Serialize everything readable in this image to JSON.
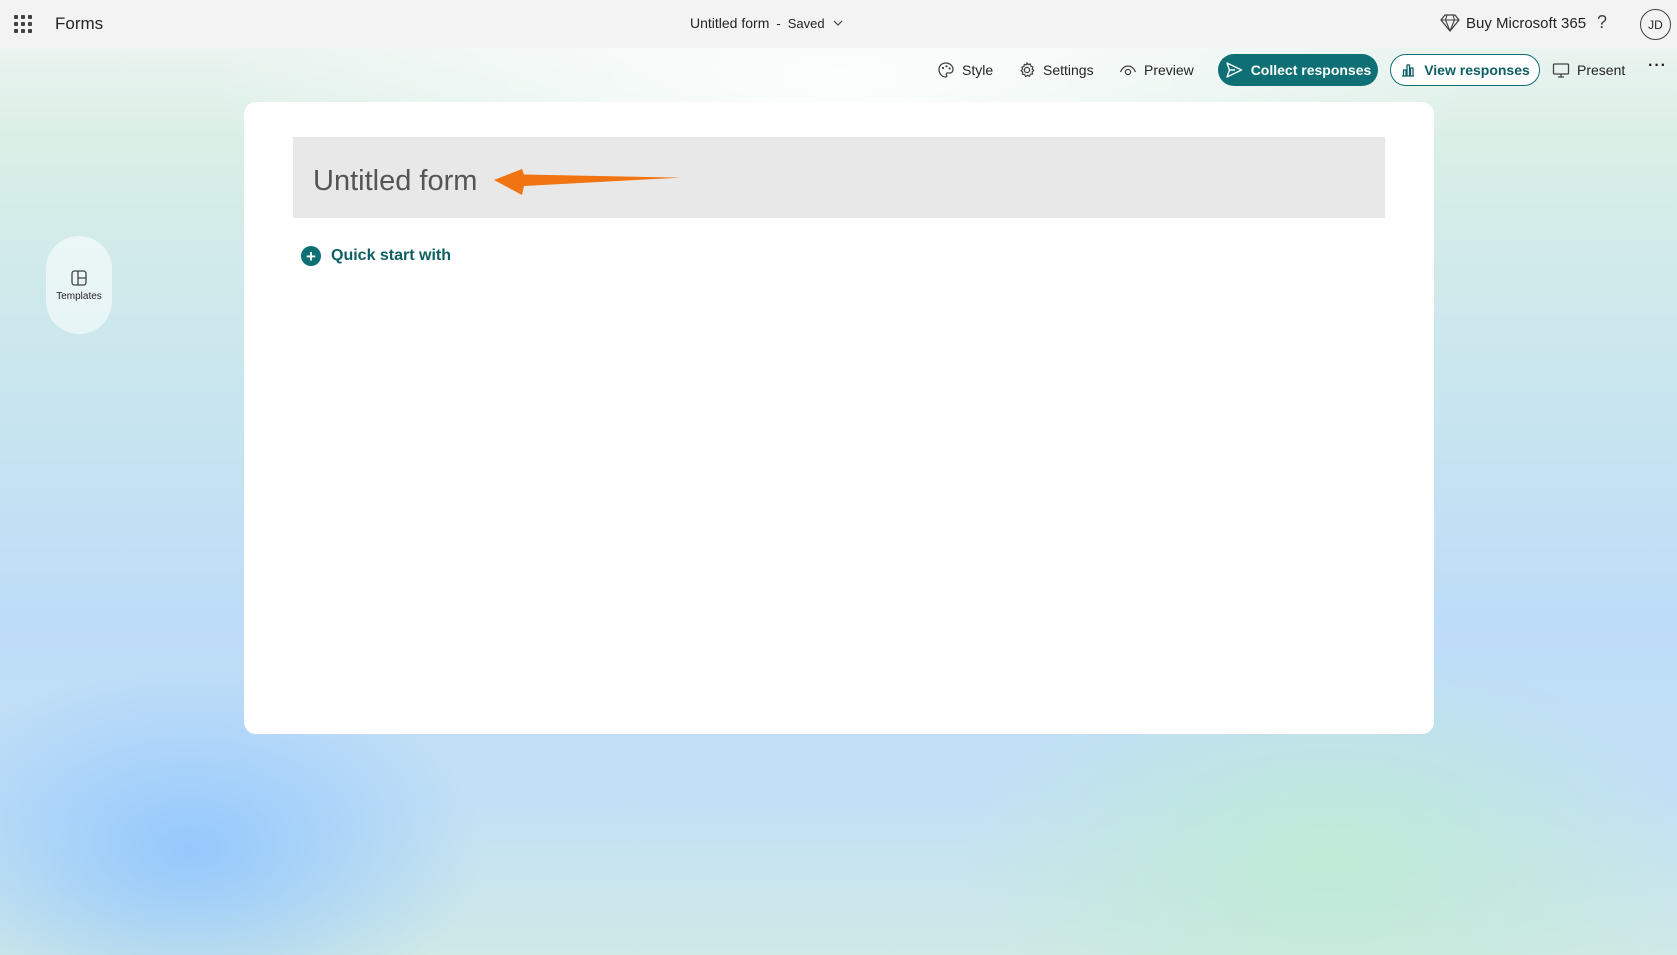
{
  "header": {
    "app_name": "Forms",
    "doc_title": "Untitled form",
    "separator": "-",
    "save_state": "Saved",
    "buy_label": "Buy Microsoft 365",
    "help_label": "?",
    "avatar_initials": "JD"
  },
  "commandbar": {
    "style_label": "Style",
    "settings_label": "Settings",
    "preview_label": "Preview",
    "collect_label": "Collect responses",
    "view_label": "View responses",
    "present_label": "Present",
    "more_label": "···"
  },
  "sidebar": {
    "templates_label": "Templates"
  },
  "form": {
    "title": "Untitled form",
    "quick_start_label": "Quick start with"
  },
  "colors": {
    "accent": "#0e6f74",
    "annotation_arrow": "#f07412"
  }
}
